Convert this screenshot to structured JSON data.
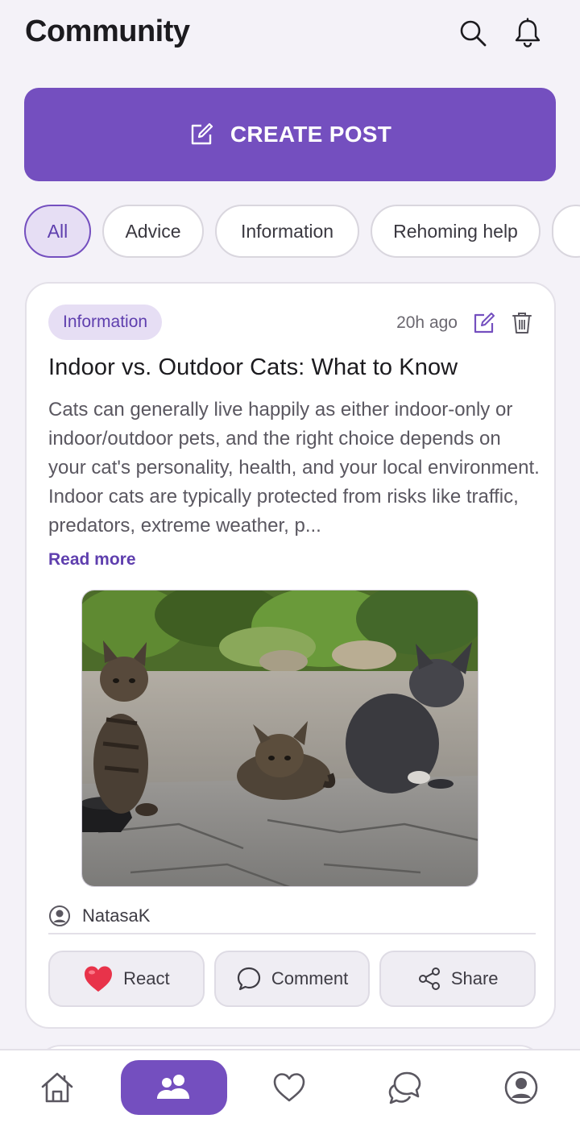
{
  "header": {
    "title": "Community"
  },
  "create_button": {
    "label": "CREATE POST"
  },
  "filters": {
    "chips": [
      "All",
      "Advice",
      "Information",
      "Rehoming help"
    ],
    "selected": "All"
  },
  "post": {
    "category": "Information",
    "time": "20h ago",
    "title": "Indoor vs. Outdoor Cats: What to Know",
    "body": "Cats can generally live happily as either indoor-only or indoor/outdoor pets, and the right choice depends on your cat's personality, health, and your local environment. Indoor cats are typically protected from risks like traffic, predators, extreme weather, p...",
    "read_more": "Read more",
    "author": "NatasaK",
    "actions": {
      "react": "React",
      "comment": "Comment",
      "share": "Share"
    }
  },
  "colors": {
    "accent": "#744fbf",
    "accent_soft": "#e6def4",
    "background": "#f4f2f8",
    "heart": "#e8334a"
  },
  "nav": {
    "items": [
      "home-icon",
      "community-icon",
      "heart-icon",
      "chat-icon",
      "profile-icon"
    ],
    "active": "community-icon"
  }
}
